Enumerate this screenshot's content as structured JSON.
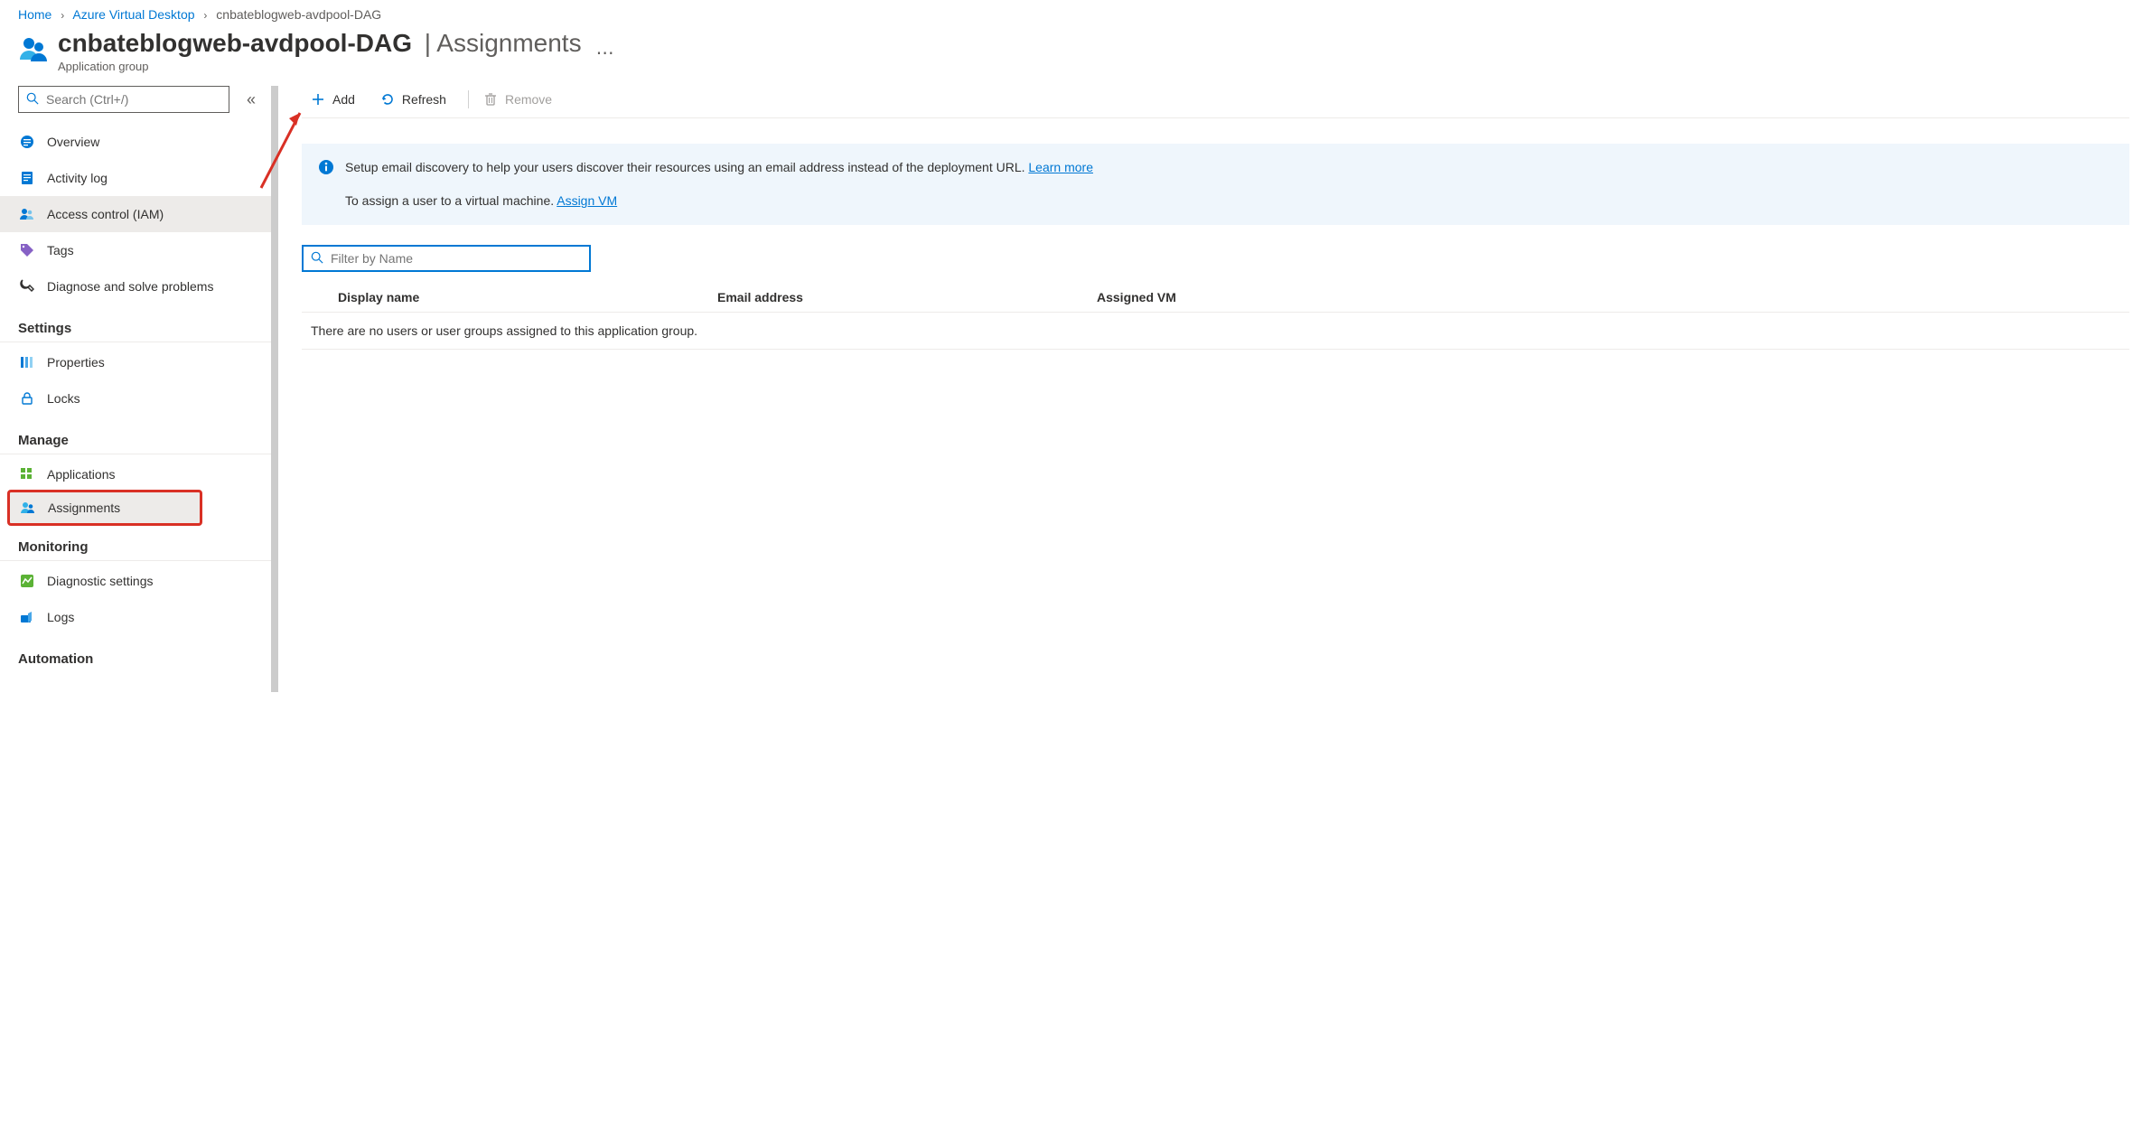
{
  "breadcrumb": {
    "home": "Home",
    "item1": "Azure Virtual Desktop",
    "current": "cnbateblogweb-avdpool-DAG"
  },
  "header": {
    "title": "cnbateblogweb-avdpool-DAG",
    "subtitle": "Assignments",
    "kind": "Application group"
  },
  "search": {
    "placeholder": "Search (Ctrl+/)"
  },
  "sidebar": {
    "groups": {
      "settings": "Settings",
      "manage": "Manage",
      "monitoring": "Monitoring",
      "automation": "Automation"
    },
    "items": [
      {
        "label": "Overview"
      },
      {
        "label": "Activity log"
      },
      {
        "label": "Access control (IAM)"
      },
      {
        "label": "Tags"
      },
      {
        "label": "Diagnose and solve problems"
      },
      {
        "label": "Properties"
      },
      {
        "label": "Locks"
      },
      {
        "label": "Applications"
      },
      {
        "label": "Assignments"
      },
      {
        "label": "Diagnostic settings"
      },
      {
        "label": "Logs"
      }
    ]
  },
  "commands": {
    "add": "Add",
    "refresh": "Refresh",
    "remove": "Remove"
  },
  "info": {
    "line1": "Setup email discovery to help your users discover their resources using an email address instead of the deployment URL.",
    "learn_more": "Learn more",
    "line2_prefix": "To assign a user to a virtual machine. ",
    "assign_vm": "Assign VM"
  },
  "filter": {
    "placeholder": "Filter by Name"
  },
  "table": {
    "col_display": "Display name",
    "col_email": "Email address",
    "col_vm": "Assigned VM",
    "empty": "There are no users or user groups assigned to this application group."
  }
}
